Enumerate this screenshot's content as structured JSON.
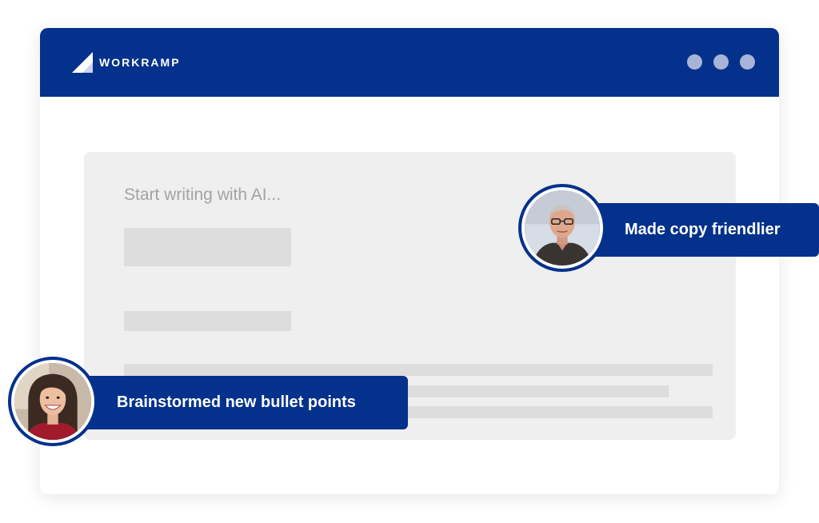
{
  "app": {
    "brand_name": "WORKRAMP",
    "window_controls": [
      "dot",
      "dot",
      "dot"
    ]
  },
  "editor": {
    "placeholder": "Start writing with AI..."
  },
  "collaborators": [
    {
      "activity": "Made copy friendlier",
      "avatar": "man-with-glasses-avatar"
    },
    {
      "activity": "Brainstormed new bullet points",
      "avatar": "smiling-woman-avatar"
    }
  ],
  "colors": {
    "brand_blue": "#04318b",
    "window_dot": "#a8b4d6",
    "editor_bg": "#efefef",
    "skeleton": "#dddddd",
    "placeholder_text": "#a3a3a3"
  }
}
